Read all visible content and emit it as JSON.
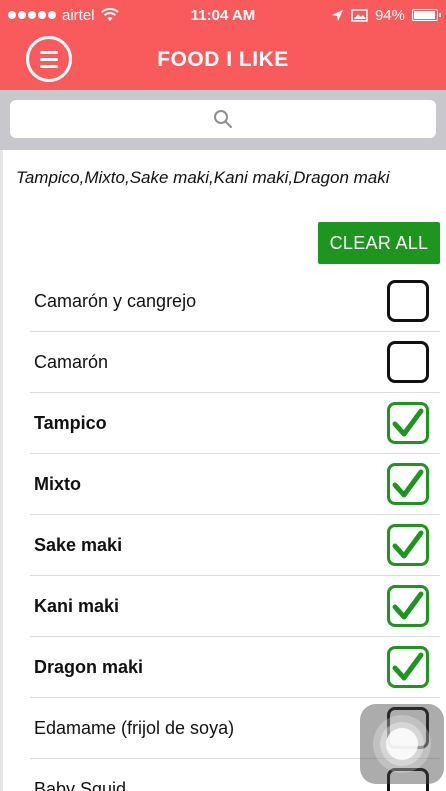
{
  "status_bar": {
    "carrier": "airtel",
    "time": "11:04 AM",
    "battery": "94%",
    "battery_level": 0.94
  },
  "header": {
    "title": "FOOD I LIKE",
    "menu_icon": "hamburger-menu-icon"
  },
  "search": {
    "placeholder": "",
    "icon": "search-icon"
  },
  "selected_summary": "Tampico,Mixto,Sake maki,Kani maki,Dragon maki",
  "clear_all_label": "CLEAR ALL",
  "colors": {
    "header": "#f95a5c",
    "accent_green": "#1e951e",
    "search_bg": "#c8c8cc"
  },
  "items": [
    {
      "label": "Camarón y cangrejo",
      "checked": false
    },
    {
      "label": "Camarón",
      "checked": false
    },
    {
      "label": "Tampico",
      "checked": true
    },
    {
      "label": "Mixto",
      "checked": true
    },
    {
      "label": "Sake maki",
      "checked": true
    },
    {
      "label": "Kani maki",
      "checked": true
    },
    {
      "label": "Dragon maki",
      "checked": true
    },
    {
      "label": "Edamame (frijol de soya)",
      "checked": false
    },
    {
      "label": "Baby Squid",
      "checked": false
    }
  ]
}
